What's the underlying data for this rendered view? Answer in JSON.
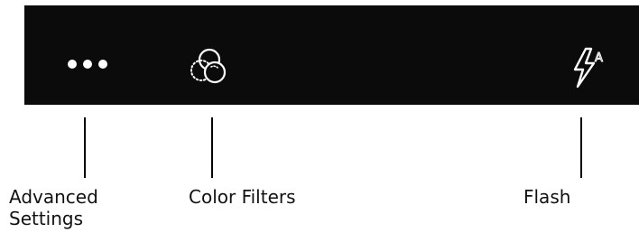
{
  "toolbar": {
    "background": "#0b0b0b",
    "icon_color": "#ffffff",
    "buttons": [
      {
        "id": "advanced-settings",
        "icon": "more-horizontal-icon"
      },
      {
        "id": "color-filters",
        "icon": "color-filters-icon"
      },
      {
        "id": "flash",
        "icon": "flash-auto-icon",
        "badge": "A"
      }
    ]
  },
  "callouts": {
    "advanced_settings": {
      "line1": "Advanced",
      "line2": "Settings"
    },
    "color_filters": {
      "label": "Color Filters"
    },
    "flash": {
      "label": "Flash"
    }
  }
}
